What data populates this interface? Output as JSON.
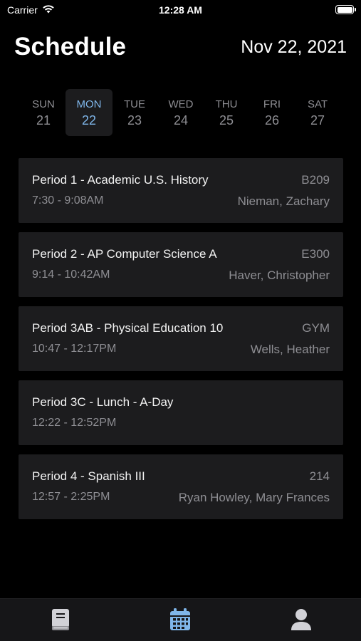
{
  "status_bar": {
    "carrier": "Carrier",
    "time": "12:28 AM",
    "battery_level": 1.0
  },
  "header": {
    "title": "Schedule",
    "date": "Nov 22, 2021"
  },
  "week": {
    "days": [
      {
        "name": "SUN",
        "date": "21"
      },
      {
        "name": "MON",
        "date": "22",
        "selected": true
      },
      {
        "name": "TUE",
        "date": "23"
      },
      {
        "name": "WED",
        "date": "24"
      },
      {
        "name": "THU",
        "date": "25"
      },
      {
        "name": "FRI",
        "date": "26"
      },
      {
        "name": "SAT",
        "date": "27"
      }
    ]
  },
  "periods": [
    {
      "name": "Period 1 - Academic U.S. History",
      "room": "B209",
      "time": "7:30 - 9:08AM",
      "teacher": "Nieman, Zachary"
    },
    {
      "name": "Period 2 - AP Computer Science A",
      "room": "E300",
      "time": "9:14 - 10:42AM",
      "teacher": "Haver, Christopher"
    },
    {
      "name": "Period 3AB - Physical Education 10",
      "room": "GYM",
      "time": "10:47 - 12:17PM",
      "teacher": "Wells, Heather"
    },
    {
      "name": "Period 3C - Lunch - A-Day",
      "room": "",
      "time": "12:22 - 12:52PM",
      "teacher": ""
    },
    {
      "name": "Period 4 - Spanish III",
      "room": "214",
      "time": "12:57 - 2:25PM",
      "teacher": "Ryan Howley, Mary Frances"
    }
  ],
  "tab_bar": {
    "tabs": [
      {
        "icon": "book-icon",
        "active": false
      },
      {
        "icon": "calendar-icon",
        "active": true
      },
      {
        "icon": "person-icon",
        "active": false
      }
    ]
  },
  "colors": {
    "accent": "#7fb6ea",
    "card_background": "#1c1c1e",
    "secondary_text": "#8e8e93"
  }
}
